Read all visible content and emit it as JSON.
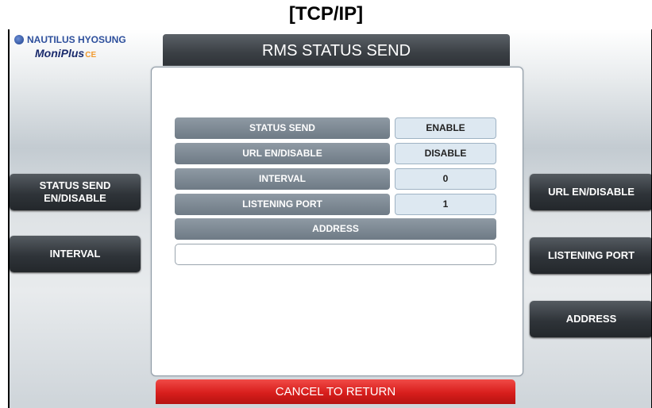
{
  "caption": "[TCP/IP]",
  "logo": {
    "brand": "NAUTILUS HYOSUNG",
    "product": "MoniPlus",
    "product_suffix": "CE"
  },
  "header": {
    "title": "RMS STATUS SEND"
  },
  "fields": {
    "status_send": {
      "label": "STATUS SEND",
      "value": "ENABLE"
    },
    "url_en_disable": {
      "label": "URL EN/DISABLE",
      "value": "DISABLE"
    },
    "interval": {
      "label": "INTERVAL",
      "value": "0"
    },
    "listening_port": {
      "label": "LISTENING PORT",
      "value": "1"
    },
    "address": {
      "label": "ADDRESS",
      "value": ""
    }
  },
  "left_buttons": {
    "status_send_line1": "STATUS SEND",
    "status_send_line2": "EN/DISABLE",
    "interval": "INTERVAL"
  },
  "right_buttons": {
    "url_en_disable": "URL EN/DISABLE",
    "listening_port": "LISTENING PORT",
    "address": "ADDRESS"
  },
  "footer": {
    "cancel": "CANCEL TO RETURN"
  },
  "colors": {
    "header_bar": "#3a3f44",
    "field_label": "#7a8691",
    "field_value": "#dde8f1",
    "side_button": "#2f3439",
    "cancel_button": "#d81e1c"
  }
}
